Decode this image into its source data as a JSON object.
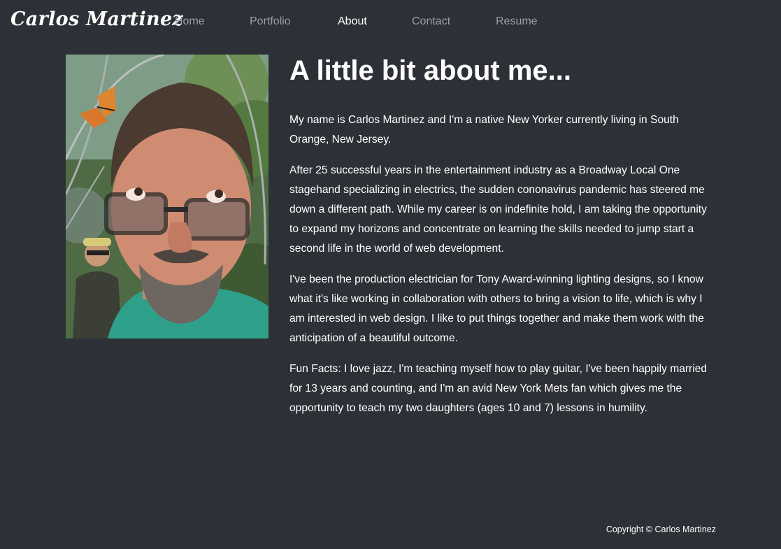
{
  "header": {
    "brand": "Carlos Martinez",
    "nav": [
      {
        "label": "Home"
      },
      {
        "label": "Portfolio"
      },
      {
        "label": "About",
        "active": true
      },
      {
        "label": "Contact"
      },
      {
        "label": "Resume"
      }
    ]
  },
  "profile_photo": {
    "icon": "profile-photo"
  },
  "main": {
    "heading": "A little bit about me...",
    "paragraphs": [
      "My name is Carlos Martinez and I'm a native New Yorker currently living in South Orange, New Jersey.",
      "After 25 successful years in the entertainment industry as a Broadway Local One stagehand specializing in electrics, the sudden cononavirus pandemic has steered me down a different path. While my career is on indefinite hold, I am taking the opportunity to expand my horizons and concentrate on learning the skills needed to jump start a second life in the world of web development.",
      "I've been the production electrician for Tony Award-winning lighting designs, so I know what it's like working in collaboration with others to bring a vision to life, which is why I am interested in web design. I like to put things together and make them work with the anticipation of a beautiful outcome.",
      "Fun Facts: I love jazz, I'm teaching myself how to play guitar, I've been happily married for 13 years and counting, and I'm an avid New York Mets fan which gives me the opportunity to teach my two daughters (ages 10 and 7) lessons in humility."
    ]
  },
  "footer": {
    "copyright": "Copyright © Carlos Martinez"
  },
  "colors": {
    "background": "#2d3137",
    "text": "#ffffff",
    "nav_inactive": "#9a9ea4"
  }
}
